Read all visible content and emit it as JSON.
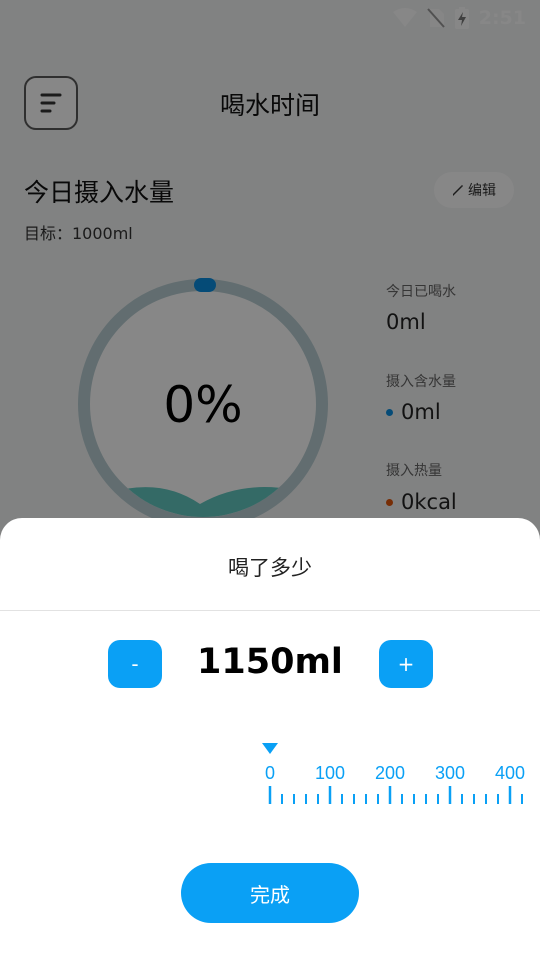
{
  "status_bar": {
    "time": "2:51"
  },
  "header": {
    "title": "喝水时间"
  },
  "intake": {
    "section_title": "今日摄入水量",
    "edit_label": "编辑",
    "goal": "目标：1000ml",
    "percent": "0%"
  },
  "stats": [
    {
      "label": "今日已喝水",
      "value": "0ml"
    },
    {
      "label": "摄入含水量",
      "value": "0ml",
      "dot_color": "#0a8fe0"
    },
    {
      "label": "摄入热量",
      "value": "0kcal",
      "dot_color": "#e0560a"
    }
  ],
  "sheet": {
    "title": "喝了多少",
    "minus_label": "-",
    "plus_label": "+",
    "amount": "1150ml",
    "ruler_ticks": [
      "0",
      "100",
      "200",
      "300",
      "400"
    ],
    "done_label": "完成"
  },
  "colors": {
    "accent": "#0aa0f5",
    "ring_track": "#b9cfd3",
    "ring_indicator": "#0a8fe0",
    "wave": "#62c8c0"
  }
}
